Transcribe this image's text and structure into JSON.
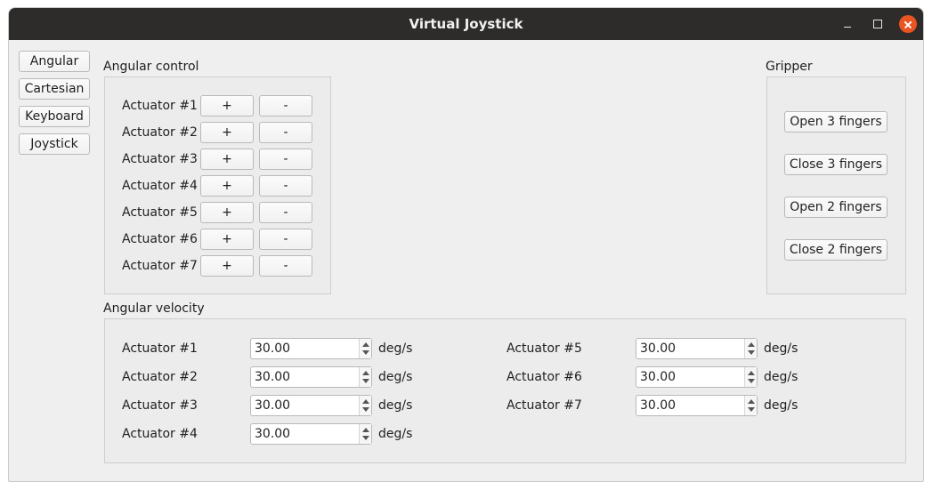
{
  "window": {
    "title": "Virtual Joystick"
  },
  "modes": [
    {
      "label": "Angular"
    },
    {
      "label": "Cartesian"
    },
    {
      "label": "Keyboard"
    },
    {
      "label": "Joystick"
    }
  ],
  "angular_control": {
    "title": "Angular control",
    "actuators": [
      {
        "label": "Actuator #1",
        "plus": "+",
        "minus": "-"
      },
      {
        "label": "Actuator #2",
        "plus": "+",
        "minus": "-"
      },
      {
        "label": "Actuator #3",
        "plus": "+",
        "minus": "-"
      },
      {
        "label": "Actuator #4",
        "plus": "+",
        "minus": "-"
      },
      {
        "label": "Actuator #5",
        "plus": "+",
        "minus": "-"
      },
      {
        "label": "Actuator #6",
        "plus": "+",
        "minus": "-"
      },
      {
        "label": "Actuator #7",
        "plus": "+",
        "minus": "-"
      }
    ]
  },
  "gripper": {
    "title": "Gripper",
    "buttons": [
      {
        "label": "Open 3 fingers"
      },
      {
        "label": "Close 3 fingers"
      },
      {
        "label": "Open 2 fingers"
      },
      {
        "label": "Close 2 fingers"
      }
    ]
  },
  "angular_velocity": {
    "title": "Angular velocity",
    "unit": "deg/s",
    "rows": [
      {
        "label": "Actuator #1",
        "value": "30.00"
      },
      {
        "label": "Actuator #2",
        "value": "30.00"
      },
      {
        "label": "Actuator #3",
        "value": "30.00"
      },
      {
        "label": "Actuator #4",
        "value": "30.00"
      },
      {
        "label": "Actuator #5",
        "value": "30.00"
      },
      {
        "label": "Actuator #6",
        "value": "30.00"
      },
      {
        "label": "Actuator #7",
        "value": "30.00"
      }
    ]
  }
}
